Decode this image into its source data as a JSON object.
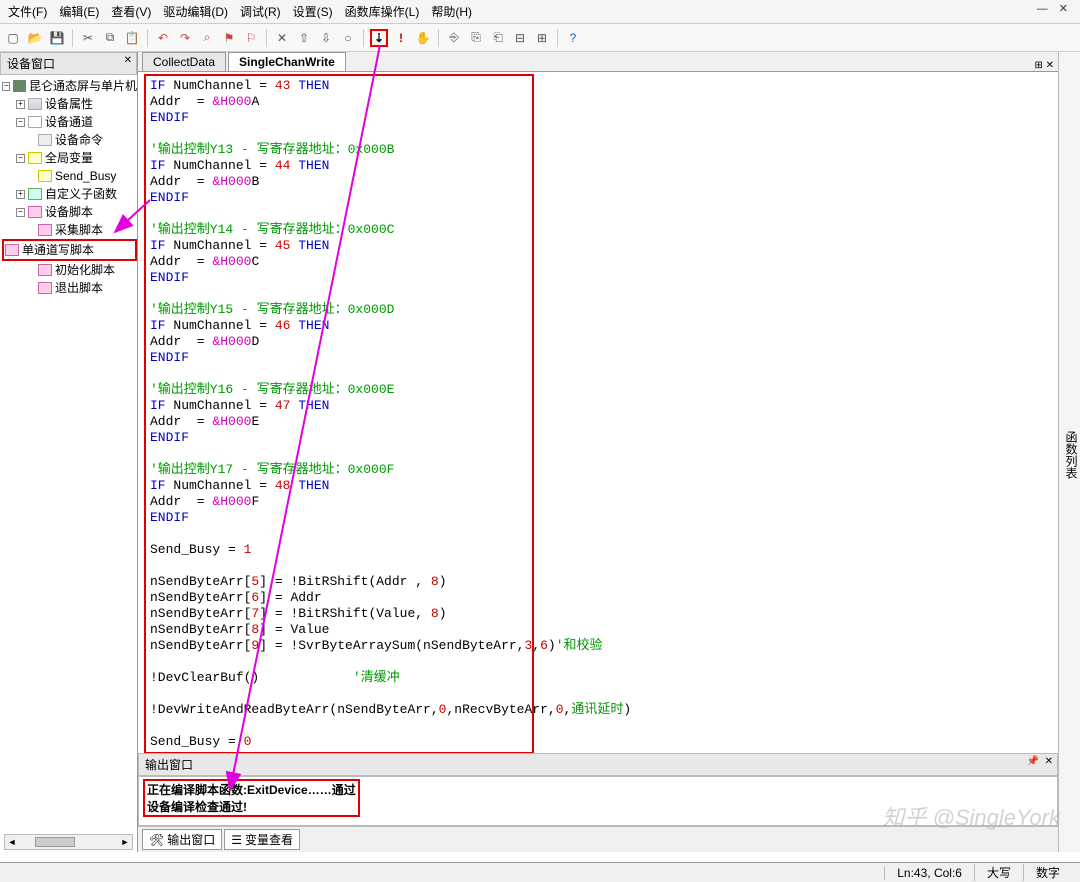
{
  "menu": {
    "file": "文件(F)",
    "edit": "编辑(E)",
    "view": "查看(V)",
    "driver": "驱动编辑(D)",
    "debug": "调试(R)",
    "settings": "设置(S)",
    "funcs": "函数库操作(L)",
    "help": "帮助(H)"
  },
  "winctl": "— ✕",
  "panel_title": "设备窗口",
  "tree": {
    "root": "昆仑通态屏与单片机",
    "prop": "设备属性",
    "chan": "设备通道",
    "cmd": "设备命令",
    "gvar": "全局变量",
    "sendbusy": "Send_Busy",
    "udf": "自定义子函数",
    "scripts": "设备脚本",
    "s1": "采集脚本",
    "s2": "单通道写脚本",
    "s3": "初始化脚本",
    "s4": "退出脚本"
  },
  "tabs": {
    "t1": "CollectData",
    "t2": "SingleChanWrite",
    "close": "⊞ ✕"
  },
  "code": {
    "l0a": "IF",
    "l0b": " NumChannel = ",
    "l0n": "43",
    "l0c": " THEN",
    "l1a": "Addr  = ",
    "l1h": "&H000",
    "l1s": "A",
    "end": "ENDIF",
    "c13": "'输出控制Y13 - 写寄存器地址：0x000B",
    "n44": "44",
    "h000": "&H000",
    "sB": "B",
    "c14": "'输出控制Y14 - 写寄存器地址：0x000C",
    "n45": "45",
    "sC": "C",
    "c15": "'输出控制Y15 - 写寄存器地址：0x000D",
    "n46": "46",
    "sD": "D",
    "c16": "'输出控制Y16 - 写寄存器地址：0x000E",
    "n47": "47",
    "sE": "E",
    "c17": "'输出控制Y17 - 写寄存器地址：0x000F",
    "n48": "48",
    "sF": "F",
    "sb1": "Send_Busy = ",
    "one": "1",
    "zero": "0",
    "a5": "nSendByteArr[",
    "i5": "5",
    "a5b": "] = !BitRShift(Addr , ",
    "n8": "8",
    "a5c": ")",
    "a6": "nSendByteArr[",
    "i6": "6",
    "a6b": "] = Addr",
    "a7": "nSendByteArr[",
    "i7": "7",
    "a7b": "] = !BitRShift(Value, ",
    "a8": "nSendByteArr[",
    "i8": "8",
    "a8b": "] = Value",
    "a9": "nSendByteArr[",
    "i9": "9",
    "a9b": "] = !SvrByteArraySum(nSendByteArr,",
    "n3": "3",
    "com": ",",
    "n6": "6",
    "a9c": ")",
    "a9cmt": "'和校验",
    "clr": "!DevClearBuf()",
    "clrcmt": "'清缓冲",
    "rw": "!DevWriteAndReadByteArr(nSendByteArr,",
    "rw0a": "0",
    "rw1": ",nRecvByteArr,",
    "rw0b": "0",
    "rw2": ",",
    "rwcmt": "通讯延时",
    "rw3": ")"
  },
  "output": {
    "title": "输出窗口",
    "l1": "正在编译脚本函数:ExitDevice……通过",
    "l2": "设备编译检查通过!"
  },
  "bottom_tabs": {
    "t1": "输出窗口",
    "t2": "变量查看"
  },
  "right_side": "函数列表",
  "status": {
    "pos": "Ln:43, Col:6",
    "caps": "大写",
    "num": "数字"
  },
  "watermark": "知乎 @SingleYork"
}
